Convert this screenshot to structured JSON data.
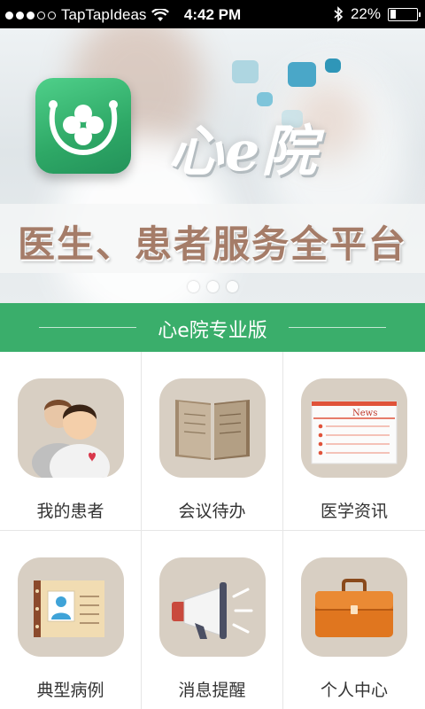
{
  "status_bar": {
    "carrier": "TapTapIdeas",
    "time": "4:42 PM",
    "battery_percent": "22%",
    "battery_level": 0.22,
    "signal_dots_filled": 3,
    "signal_dots_total": 5
  },
  "banner": {
    "brand": "心e院",
    "slogan": "医生、患者服务全平台",
    "pages": 3,
    "active_page": 0
  },
  "title_bar": {
    "title": "心e院专业版"
  },
  "menu": [
    {
      "label": "我的患者",
      "icon": "patients-icon"
    },
    {
      "label": "会议待办",
      "icon": "book-icon"
    },
    {
      "label": "医学资讯",
      "icon": "news-icon",
      "icon_text": "News"
    },
    {
      "label": "典型病例",
      "icon": "case-record-icon"
    },
    {
      "label": "消息提醒",
      "icon": "megaphone-icon"
    },
    {
      "label": "个人中心",
      "icon": "briefcase-icon"
    }
  ],
  "colors": {
    "accent_green": "#3aae6b",
    "icon_bg": "#d8cfc3",
    "slogan": "#a57c68"
  }
}
